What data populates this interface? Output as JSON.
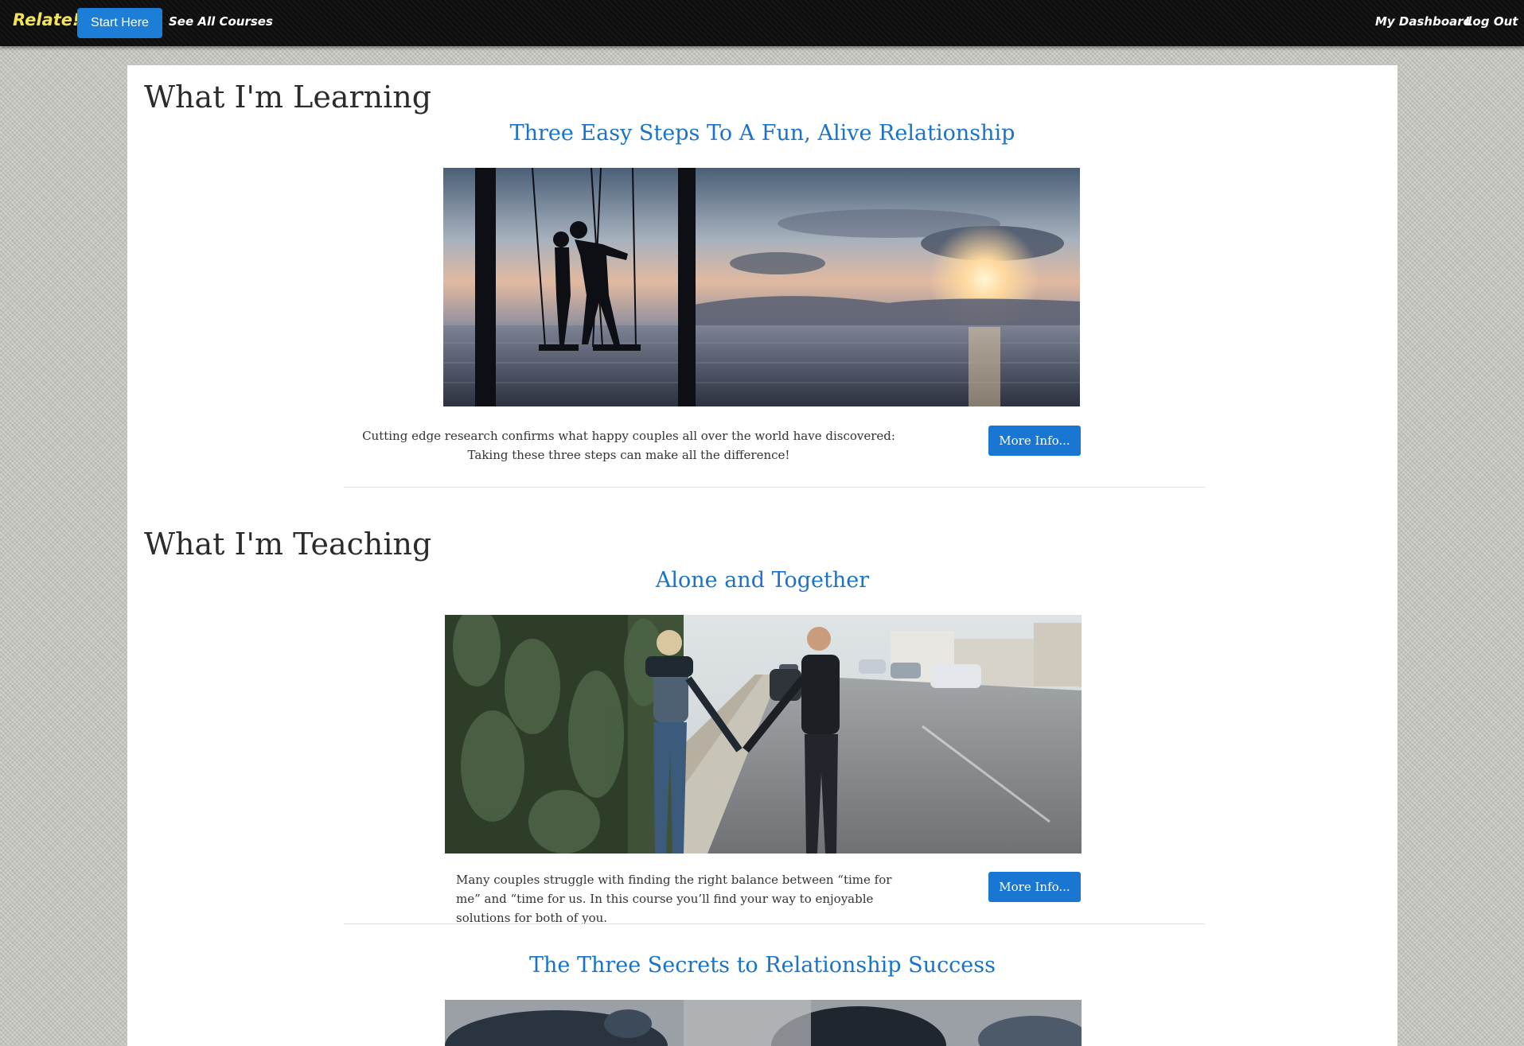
{
  "navbar": {
    "brand": "Relate!",
    "start_button": "Start Here",
    "see_all_courses": "See All Courses",
    "my_dashboard": "My Dashboard",
    "log_out": "Log Out"
  },
  "learning": {
    "heading": "What I'm Learning",
    "courses": [
      {
        "title": "Three Easy Steps To A Fun, Alive Relationship",
        "description": "Cutting edge research confirms what happy couples all over the world have discovered: Taking these three steps can make all the difference!",
        "button": "More Info..."
      }
    ]
  },
  "teaching": {
    "heading": "What I'm Teaching",
    "courses": [
      {
        "title": "Alone and Together",
        "description": "Many couples struggle with finding the right balance between “time for me” and “time for us. In this course you’ll find your way to enjoyable solutions for both of you.",
        "button": "More Info..."
      },
      {
        "title": "The Three Secrets to Relationship Success"
      }
    ]
  },
  "colors": {
    "accent": "#1976d2",
    "link": "#1a73c9",
    "brand": "#f2e35b",
    "navbar": "#0e0e0e"
  }
}
